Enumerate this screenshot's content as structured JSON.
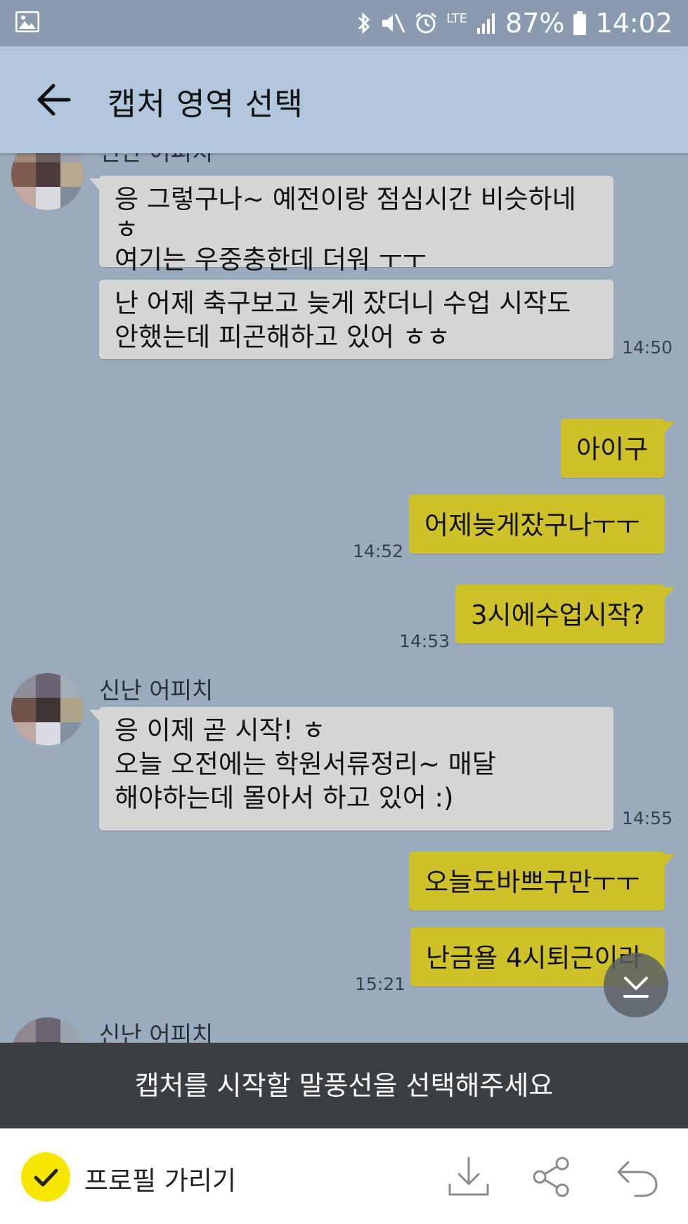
{
  "status_bar": {
    "battery": "87%",
    "time": "14:02",
    "network": "LTE",
    "icons": [
      "image-icon",
      "bluetooth-icon",
      "mute-icon",
      "alarm-icon",
      "lte-icon",
      "signal-icon",
      "battery-icon"
    ]
  },
  "app_bar": {
    "title": "캡처 영역 선택",
    "back_icon": "arrow-left-icon"
  },
  "chat": {
    "top_sender": "신난 어피치",
    "msg1": [
      "응 그렇구나~ 예전이랑 점심시간 비슷하네",
      "ㅎ",
      "여기는 우중충한데 더워 ㅜㅜ"
    ],
    "msg2": [
      "난 어제 축구보고 늦게 잤더니 수업 시작도",
      "안했는데 피곤해하고 있어 ㅎㅎ"
    ],
    "msg2_time": "14:50",
    "out1": "아이구",
    "out2": "어제늦게잤구나ㅜㅜ",
    "out2_time": "14:52",
    "out3": "3시에수업시작?",
    "out3_time": "14:53",
    "sender2": "신난 어피치",
    "msg3": [
      "응 이제 곧 시작! ㅎ",
      "오늘 오전에는 학원서류정리~ 매달",
      "해야하는데 몰아서 하고 있어 :)"
    ],
    "msg3_time": "14:55",
    "out4": "오늘도바쁘구만ㅜㅜ",
    "out5": "난금욜 4시퇴근이라",
    "out5_time": "15:21",
    "sender3": "신난 어피치"
  },
  "banner": {
    "text": "캡처를 시작할 말풍선을 선택해주세요"
  },
  "bottom_bar": {
    "hide_profile_label": "프로필 가리기",
    "tools": [
      "download-icon",
      "share-icon",
      "undo-icon"
    ]
  },
  "colors": {
    "chat_bg": "#9aabbe",
    "app_bar": "#b2c7dd",
    "incoming_bubble": "#d5d5d5",
    "outgoing_bubble": "#cfc12a",
    "check_accent": "#f7e600",
    "banner": "#3b3f42"
  }
}
